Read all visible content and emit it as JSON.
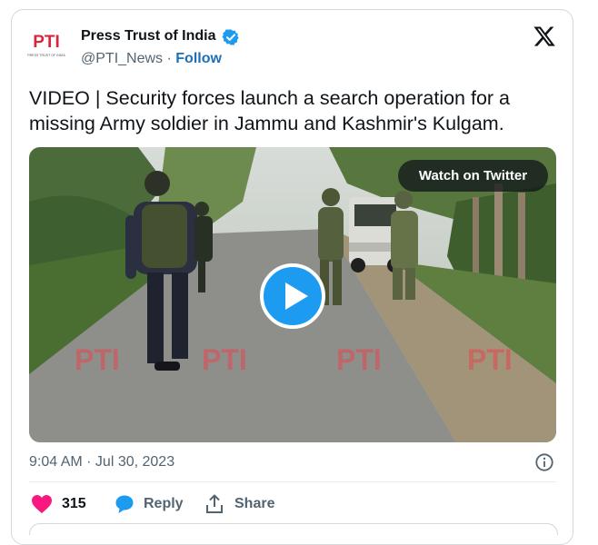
{
  "author": {
    "name": "Press Trust of India",
    "handle": "@PTI_News",
    "separator": "·",
    "follow_label": "Follow",
    "logo_text": "PTI",
    "logo_tagline": "PRESS TRUST OF INDIA",
    "verified": true
  },
  "platform_icon": "x-logo-icon",
  "tweet": {
    "text": "VIDEO | Security forces launch a search operation for a missing Army soldier in Jammu and Kashmir's Kulgam."
  },
  "video": {
    "watch_label": "Watch on Twitter",
    "watermark": "PTI",
    "play_icon": "play-icon"
  },
  "timestamp": "9:04 AM · Jul 30, 2023",
  "actions": {
    "like_count": "315",
    "reply_label": "Reply",
    "share_label": "Share"
  },
  "colors": {
    "brand_blue": "#1d9bf0",
    "like_red": "#f91880",
    "text_primary": "#0f1419",
    "text_secondary": "#536471",
    "pti_red": "#d7263d"
  }
}
